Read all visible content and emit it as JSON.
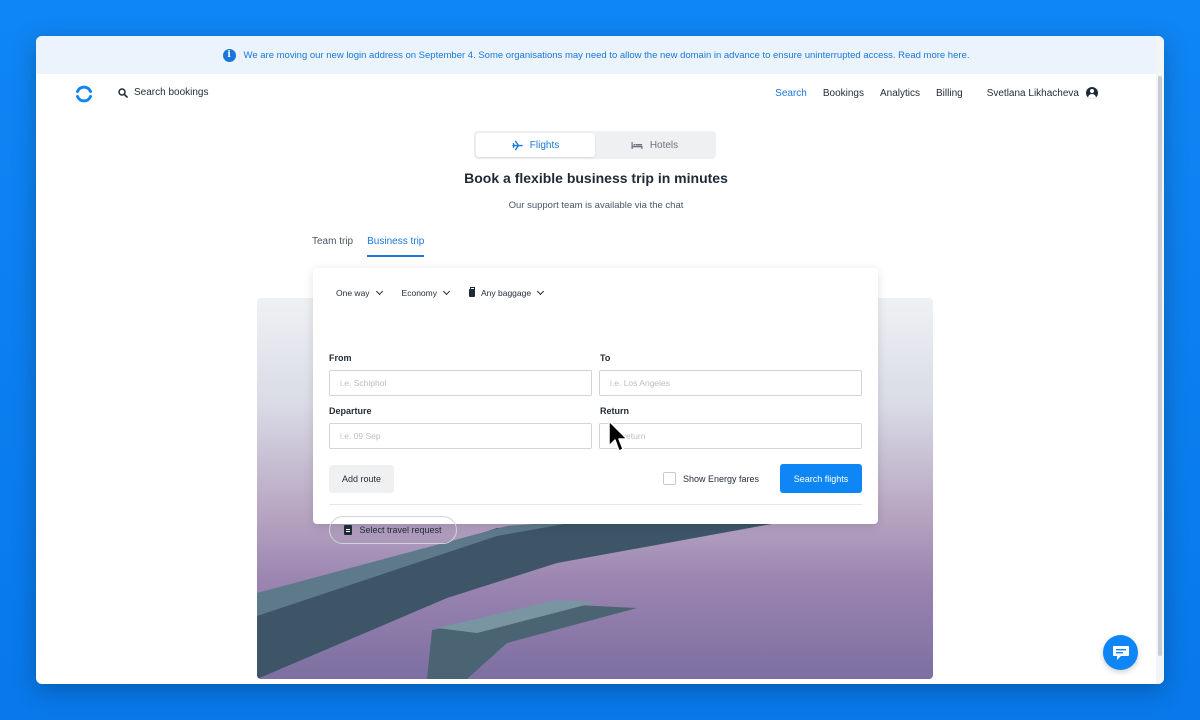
{
  "banner": {
    "text": "We are moving our new login address on September 4. Some organisations may need to allow the new domain in advance to ensure uninterrupted access. Read more here."
  },
  "header": {
    "search_label": "Search bookings",
    "nav": [
      "Search",
      "Bookings",
      "Analytics",
      "Billing"
    ],
    "active_nav": "Search",
    "user_name": "Svetlana Likhacheva"
  },
  "mode_toggle": {
    "flights": "Flights",
    "hotels": "Hotels",
    "selected": "Flights"
  },
  "main": {
    "title": "Book a flexible business trip in minutes",
    "subtitle": "Our support team is available via the chat"
  },
  "trip_tabs": {
    "team": "Team trip",
    "business": "Business trip",
    "selected": "Business trip"
  },
  "form": {
    "trip_type": "One way",
    "cabin_class": "Economy",
    "baggage": "Any baggage",
    "from_label": "From",
    "from_placeholder": "i.e. Schiphol",
    "to_label": "To",
    "to_placeholder": "i.e. Los Angeles",
    "departure_label": "Departure",
    "departure_placeholder": "i.e. 09 Sep",
    "return_label": "Return",
    "return_placeholder": "No return",
    "add_route": "Add route",
    "energy_fares": "Show Energy fares",
    "energy_checked": false,
    "search_button": "Search flights",
    "travel_request": "Select travel request"
  },
  "colors": {
    "accent": "#0f86f5",
    "page_background": "#0a7ef0",
    "banner_background": "#ebf3fc"
  }
}
